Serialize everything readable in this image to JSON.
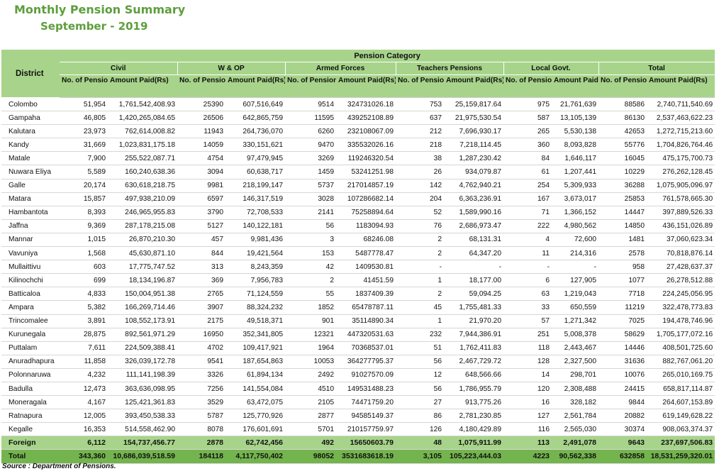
{
  "title": "Monthly Pension Summary",
  "subtitle": "September - 2019",
  "header": {
    "district": "District",
    "pension_category": "Pension Category",
    "groups": [
      "Civil",
      "W & OP",
      "Armed Forces",
      "Teachers Pensions",
      "Local Govt.",
      "Total"
    ],
    "no_of_pensioners": "No. of Pensioners",
    "amount_paid": "Amount Paid(Rs)"
  },
  "rows": [
    [
      "Colombo",
      "51,954",
      "1,761,542,408.93",
      "25390",
      "607,516,649",
      "9514",
      "324731026.18",
      "753",
      "25,159,817.64",
      "975",
      "21,761,639",
      "88586",
      "2,740,711,540.69"
    ],
    [
      "Gampaha",
      "46,805",
      "1,420,265,084.65",
      "26506",
      "642,865,759",
      "11595",
      "439252108.89",
      "637",
      "21,975,530.54",
      "587",
      "13,105,139",
      "86130",
      "2,537,463,622.23"
    ],
    [
      "Kalutara",
      "23,973",
      "762,614,008.82",
      "11943",
      "264,736,070",
      "6260",
      "232108067.09",
      "212",
      "7,696,930.17",
      "265",
      "5,530,138",
      "42653",
      "1,272,715,213.60"
    ],
    [
      "Kandy",
      "31,669",
      "1,023,831,175.18",
      "14059",
      "330,151,621",
      "9470",
      "335532026.16",
      "218",
      "7,218,114.45",
      "360",
      "8,093,828",
      "55776",
      "1,704,826,764.46"
    ],
    [
      "Matale",
      "7,900",
      "255,522,087.71",
      "4754",
      "97,479,945",
      "3269",
      "119246320.54",
      "38",
      "1,287,230.42",
      "84",
      "1,646,117",
      "16045",
      "475,175,700.73"
    ],
    [
      "Nuwara Eliya",
      "5,589",
      "160,240,638.36",
      "3094",
      "60,638,717",
      "1459",
      "53241251.98",
      "26",
      "934,079.87",
      "61",
      "1,207,441",
      "10229",
      "276,262,128.45"
    ],
    [
      "Galle",
      "20,174",
      "630,618,218.75",
      "9981",
      "218,199,147",
      "5737",
      "217014857.19",
      "142",
      "4,762,940.21",
      "254",
      "5,309,933",
      "36288",
      "1,075,905,096.97"
    ],
    [
      "Matara",
      "15,857",
      "497,938,210.09",
      "6597",
      "146,317,519",
      "3028",
      "107286682.14",
      "204",
      "6,363,236.91",
      "167",
      "3,673,017",
      "25853",
      "761,578,665.30"
    ],
    [
      "Hambantota",
      "8,393",
      "246,965,955.83",
      "3790",
      "72,708,533",
      "2141",
      "75258894.64",
      "52",
      "1,589,990.16",
      "71",
      "1,366,152",
      "14447",
      "397,889,526.33"
    ],
    [
      "Jaffna",
      "9,369",
      "287,178,215.08",
      "5127",
      "140,122,181",
      "56",
      "1183094.93",
      "76",
      "2,686,973.47",
      "222",
      "4,980,562",
      "14850",
      "436,151,026.89"
    ],
    [
      "Mannar",
      "1,015",
      "26,870,210.30",
      "457",
      "9,981,436",
      "3",
      "68246.08",
      "2",
      "68,131.31",
      "4",
      "72,600",
      "1481",
      "37,060,623.34"
    ],
    [
      "Vavuniya",
      "1,568",
      "45,630,871.10",
      "844",
      "19,421,564",
      "153",
      "5487778.47",
      "2",
      "64,347.20",
      "11",
      "214,316",
      "2578",
      "70,818,876.14"
    ],
    [
      "Mullaittivu",
      "603",
      "17,775,747.52",
      "313",
      "8,243,359",
      "42",
      "1409530.81",
      "-",
      "-",
      "-",
      "-",
      "958",
      "27,428,637.37"
    ],
    [
      "Kilinochchi",
      "699",
      "18,134,196.87",
      "369",
      "7,956,783",
      "2",
      "41451.59",
      "1",
      "18,177.00",
      "6",
      "127,905",
      "1077",
      "26,278,512.88"
    ],
    [
      "Batticaloa",
      "4,833",
      "150,004,951.38",
      "2765",
      "71,124,559",
      "55",
      "1837409.39",
      "2",
      "59,094.25",
      "63",
      "1,219,043",
      "7718",
      "224,245,056.95"
    ],
    [
      "Ampara",
      "5,382",
      "166,269,714.46",
      "3907",
      "88,324,232",
      "1852",
      "65478787.11",
      "45",
      "1,755,481.33",
      "33",
      "650,559",
      "11219",
      "322,478,773.83"
    ],
    [
      "Trincomalee",
      "3,891",
      "108,552,173.91",
      "2175",
      "49,518,371",
      "901",
      "35114890.34",
      "1",
      "21,970.20",
      "57",
      "1,271,342",
      "7025",
      "194,478,746.96"
    ],
    [
      "Kurunegala",
      "28,875",
      "892,561,971.29",
      "16950",
      "352,341,805",
      "12321",
      "447320531.63",
      "232",
      "7,944,386.91",
      "251",
      "5,008,378",
      "58629",
      "1,705,177,072.16"
    ],
    [
      "Puttalam",
      "7,611",
      "224,509,388.41",
      "4702",
      "109,417,921",
      "1964",
      "70368537.01",
      "51",
      "1,762,411.83",
      "118",
      "2,443,467",
      "14446",
      "408,501,725.60"
    ],
    [
      "Anuradhapura",
      "11,858",
      "326,039,172.78",
      "9541",
      "187,654,863",
      "10053",
      "364277795.37",
      "56",
      "2,467,729.72",
      "128",
      "2,327,500",
      "31636",
      "882,767,061.20"
    ],
    [
      "Polonnaruwa",
      "4,232",
      "111,141,198.39",
      "3326",
      "61,894,134",
      "2492",
      "91027570.09",
      "12",
      "648,566.66",
      "14",
      "298,701",
      "10076",
      "265,010,169.75"
    ],
    [
      "Badulla",
      "12,473",
      "363,636,098.95",
      "7256",
      "141,554,084",
      "4510",
      "149531488.23",
      "56",
      "1,786,955.79",
      "120",
      "2,308,488",
      "24415",
      "658,817,114.87"
    ],
    [
      "Moneragala",
      "4,167",
      "125,421,361.83",
      "3529",
      "63,472,075",
      "2105",
      "74471759.20",
      "27",
      "913,775.26",
      "16",
      "328,182",
      "9844",
      "264,607,153.89"
    ],
    [
      "Ratnapura",
      "12,005",
      "393,450,538.33",
      "5787",
      "125,770,926",
      "2877",
      "94585149.37",
      "86",
      "2,781,230.85",
      "127",
      "2,561,784",
      "20882",
      "619,149,628.22"
    ],
    [
      "Kegalle",
      "16,353",
      "514,558,462.90",
      "8078",
      "176,601,691",
      "5701",
      "210157759.97",
      "126",
      "4,180,429.89",
      "116",
      "2,565,030",
      "30374",
      "908,063,374.37"
    ]
  ],
  "foreign": [
    "Foreign",
    "6,112",
    "154,737,456.77",
    "2878",
    "62,742,456",
    "492",
    "15650603.79",
    "48",
    "1,075,911.99",
    "113",
    "2,491,078",
    "9643",
    "237,697,506.83"
  ],
  "total": [
    "Total",
    "343,360",
    "10,686,039,518.59",
    "184118",
    "4,117,750,402",
    "98052",
    "3531683618.19",
    "3,105",
    "105,223,444.03",
    "4223",
    "90,562,338",
    "632858",
    "18,531,259,320.01"
  ],
  "source": "Source : Department of Pensions."
}
